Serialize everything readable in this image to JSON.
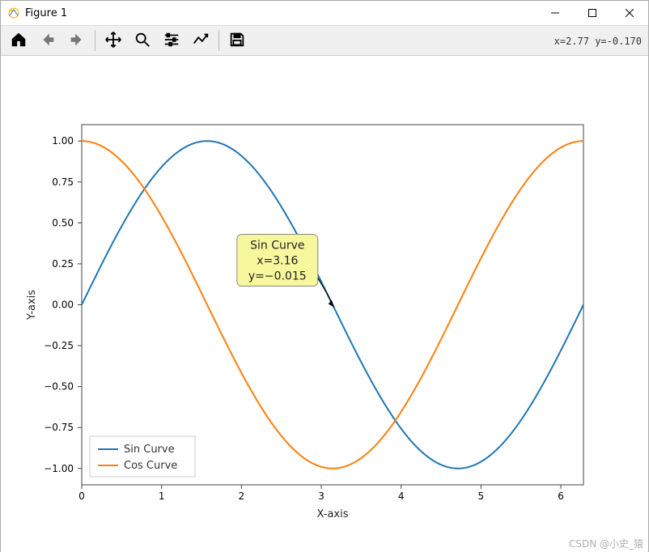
{
  "window": {
    "title": "Figure 1"
  },
  "status": {
    "coord": "x=2.77  y=-0.170"
  },
  "toolbar": {
    "home": "Home",
    "back": "Back",
    "forward": "Forward",
    "pan": "Pan",
    "zoom": "Zoom",
    "subplots": "Configure subplots",
    "edit": "Edit axis",
    "save": "Save"
  },
  "legend": {
    "s1": "Sin Curve",
    "s2": "Cos Curve"
  },
  "tooltip": {
    "line1": "Sin Curve",
    "line2": "x=3.16",
    "line3": "y=−0.015"
  },
  "axes": {
    "xlabel": "X-axis",
    "ylabel": "Y-axis"
  },
  "xticks": [
    "0",
    "1",
    "2",
    "3",
    "4",
    "5",
    "6"
  ],
  "yticks": [
    "−1.00",
    "−0.75",
    "−0.50",
    "−0.25",
    "0.00",
    "0.25",
    "0.50",
    "0.75",
    "1.00"
  ],
  "watermark": "CSDN @小史_猿",
  "colors": {
    "sin": "#1f77b4",
    "cos": "#ff7f0e",
    "axis": "#444"
  },
  "chart_data": {
    "type": "line",
    "xlabel": "X-axis",
    "ylabel": "Y-axis",
    "xlim": [
      0,
      6.2832
    ],
    "ylim": [
      -1.1,
      1.1
    ],
    "series": [
      {
        "name": "Sin Curve",
        "color": "#1f77b4",
        "fn": "sin(x)",
        "x_range": [
          0,
          6.2832
        ]
      },
      {
        "name": "Cos Curve",
        "color": "#ff7f0e",
        "fn": "cos(x)",
        "x_range": [
          0,
          6.2832
        ]
      }
    ],
    "legend_position": "lower left",
    "tooltip": {
      "series": "Sin Curve",
      "x": 3.16,
      "y": -0.015
    }
  }
}
